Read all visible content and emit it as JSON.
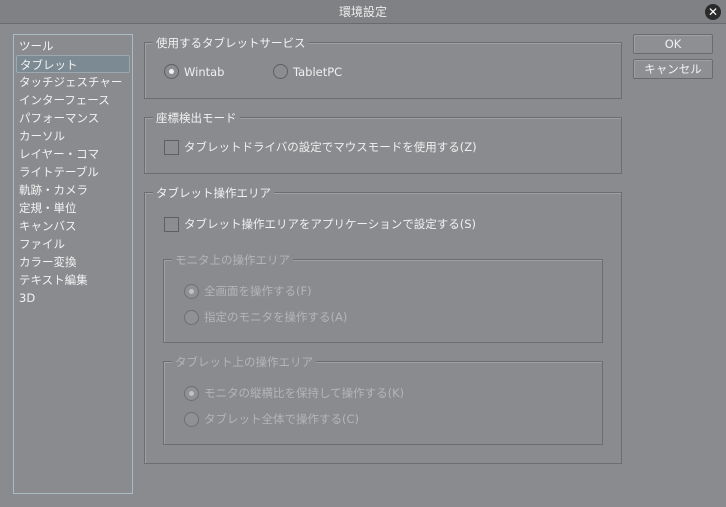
{
  "window": {
    "title": "環境設定"
  },
  "sidebar": {
    "items": [
      "ツール",
      "タブレット",
      "タッチジェスチャー",
      "インターフェース",
      "パフォーマンス",
      "カーソル",
      "レイヤー・コマ",
      "ライトテーブル",
      "軌跡・カメラ",
      "定規・単位",
      "キャンバス",
      "ファイル",
      "カラー変換",
      "テキスト編集",
      "3D"
    ],
    "selected": "タブレット"
  },
  "service": {
    "label": "使用するタブレットサービス",
    "options": [
      "Wintab",
      "TabletPC"
    ],
    "selected": "Wintab"
  },
  "coord": {
    "label": "座標検出モード",
    "checkbox": "タブレットドライバの設定でマウスモードを使用する(Z)",
    "checked": false
  },
  "area": {
    "label": "タブレット操作エリア",
    "checkbox": "タブレット操作エリアをアプリケーションで設定する(S)",
    "checked": false,
    "monitor": {
      "label": "モニタ上の操作エリア",
      "options": [
        "全画面を操作する(F)",
        "指定のモニタを操作する(A)"
      ],
      "selected": "全画面を操作する(F)"
    },
    "tablet": {
      "label": "タブレット上の操作エリア",
      "options": [
        "モニタの縦横比を保持して操作する(K)",
        "タブレット全体で操作する(C)"
      ],
      "selected": "モニタの縦横比を保持して操作する(K)"
    }
  },
  "buttons": {
    "ok": "OK",
    "cancel": "キャンセル"
  }
}
